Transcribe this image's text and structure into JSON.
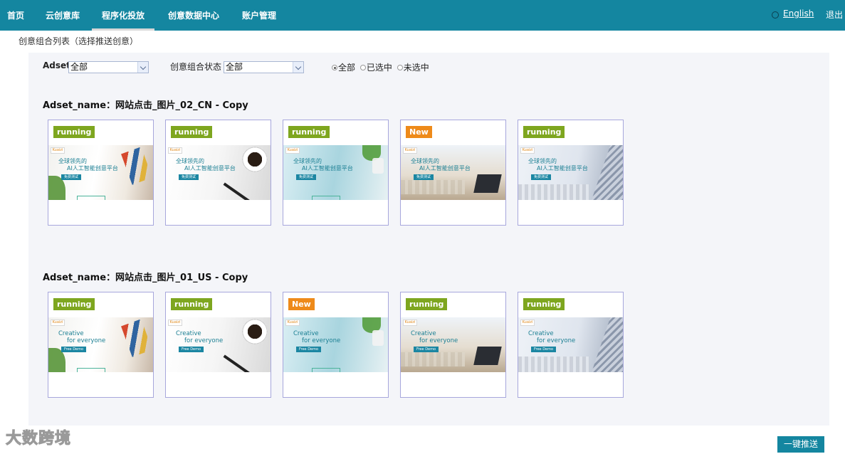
{
  "nav": {
    "items": [
      {
        "label": "首页"
      },
      {
        "label": "云创意库"
      },
      {
        "label": "程序化投放",
        "active": true
      },
      {
        "label": "创意数据中心"
      },
      {
        "label": "账户管理"
      }
    ],
    "language": "English",
    "logout": "退出"
  },
  "page": {
    "subtitle": "创意组合列表（选择推送创意）"
  },
  "filters": {
    "adset_label": "Adset",
    "adset_value": "全部",
    "status_label": "创意组合状态",
    "status_value": "全部",
    "radio_options": [
      {
        "label": "全部",
        "checked": true
      },
      {
        "label": "已选中",
        "checked": false
      },
      {
        "label": "未选中",
        "checked": false
      }
    ]
  },
  "adsets": [
    {
      "title": "Adset_name：网站点击_图片_02_CN - Copy",
      "creatives": [
        {
          "status": "running",
          "variant": "s0",
          "logo": "Kuaizi",
          "headline1": "全球领先的",
          "headline2": "AI人工智能创意平台",
          "cta": "免费测试"
        },
        {
          "status": "running",
          "variant": "s1",
          "logo": "Kuaizi",
          "headline1": "全球领先的",
          "headline2": "AI人工智能创意平台",
          "cta": "免费测试"
        },
        {
          "status": "running",
          "variant": "s2",
          "logo": "Kuaizi",
          "headline1": "全球领先的",
          "headline2": "AI人工智能创意平台",
          "cta": "免费测试"
        },
        {
          "status": "New",
          "variant": "s3",
          "logo": "Kuaizi",
          "headline1": "全球领先的",
          "headline2": "AI人工智能创意平台",
          "cta": "免费测试"
        },
        {
          "status": "running",
          "variant": "s4",
          "logo": "Kuaizi",
          "headline1": "全球领先的",
          "headline2": "AI人工智能创意平台",
          "cta": "免费测试"
        }
      ]
    },
    {
      "title": "Adset_name：网站点击_图片_01_US - Copy",
      "creatives": [
        {
          "status": "running",
          "variant": "s0",
          "logo": "Kuaizi",
          "headline1": "Creative",
          "headline2": "for everyone",
          "cta": "Free Demo"
        },
        {
          "status": "running",
          "variant": "s1",
          "logo": "Kuaizi",
          "headline1": "Creative",
          "headline2": "for everyone",
          "cta": "Free Demo"
        },
        {
          "status": "New",
          "variant": "s2",
          "logo": "Kuaizi",
          "headline1": "Creative",
          "headline2": "for everyone",
          "cta": "Free Demo"
        },
        {
          "status": "running",
          "variant": "s3",
          "logo": "Kuaizi",
          "headline1": "Creative",
          "headline2": "for everyone",
          "cta": "Free Demo"
        },
        {
          "status": "running",
          "variant": "s4",
          "logo": "Kuaizi",
          "headline1": "Creative",
          "headline2": "for everyone",
          "cta": "Free Demo"
        }
      ]
    }
  ],
  "actions": {
    "push_label": "一键推送"
  },
  "watermark": "大数跨境",
  "colors": {
    "nav_bg": "#1486a0",
    "running": "#7ea61f",
    "new": "#ee8a1a",
    "card_border": "#a7a7dc"
  }
}
